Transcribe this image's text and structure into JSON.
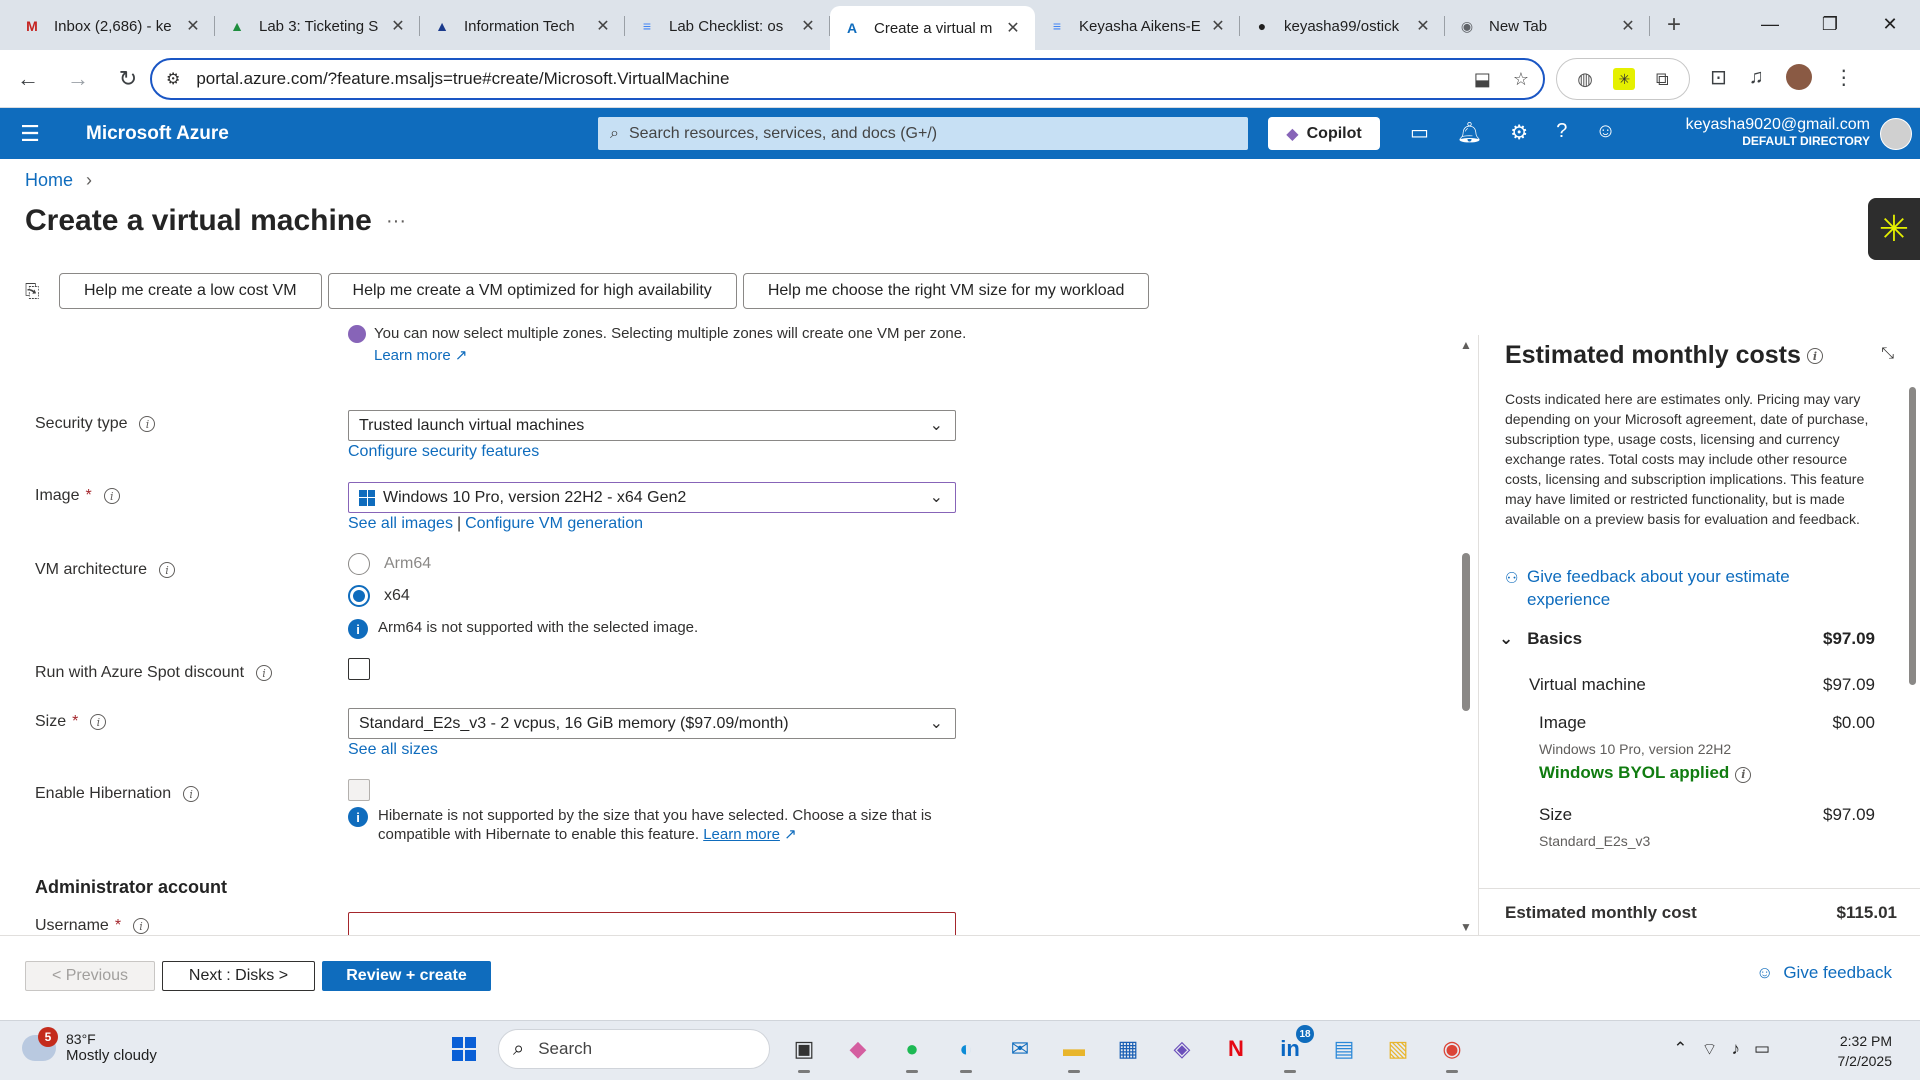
{
  "browser": {
    "tabs": [
      {
        "title": "Inbox (2,686) - ke",
        "icon": "gmail-icon",
        "color": "#c5221f",
        "glyph": "M"
      },
      {
        "title": "Lab 3: Ticketing S",
        "icon": "drive-icon",
        "color": "#1e8e3e",
        "glyph": "▲"
      },
      {
        "title": "Information Tech",
        "icon": "azure-devops-icon",
        "color": "#1a3a8c",
        "glyph": "▲"
      },
      {
        "title": "Lab Checklist: os",
        "icon": "docs-icon",
        "color": "#4285f4",
        "glyph": "≡"
      },
      {
        "title": "Create a virtual m",
        "icon": "azure-icon",
        "color": "#0f6cbd",
        "glyph": "A"
      },
      {
        "title": "Keyasha Aikens-E",
        "icon": "docs-icon",
        "color": "#4285f4",
        "glyph": "≡"
      },
      {
        "title": "keyasha99/ostick",
        "icon": "github-icon",
        "color": "#1f1f1f",
        "glyph": "●"
      },
      {
        "title": "New Tab",
        "icon": "chrome-icon",
        "color": "#5f6368",
        "glyph": "◉"
      }
    ],
    "url": "portal.azure.com/?feature.msaljs=true#create/Microsoft.VirtualMachine"
  },
  "azure": {
    "brand": "Microsoft Azure",
    "search_placeholder": "Search resources, services, and docs (G+/)",
    "copilot": "Copilot",
    "account_email": "keyasha9020@gmail.com",
    "account_dir": "DEFAULT DIRECTORY"
  },
  "page": {
    "breadcrumb_home": "Home",
    "title": "Create a virtual machine",
    "help_buttons": [
      "Help me create a low cost VM",
      "Help me create a VM optimized for high availability",
      "Help me choose the right VM size for my workload"
    ]
  },
  "form": {
    "zone_note": "You can now select multiple zones. Selecting multiple zones will create one VM per zone.",
    "zone_note_link": "Learn more",
    "security_type_label": "Security type",
    "security_type_value": "Trusted launch virtual machines",
    "security_link": "Configure security features",
    "image_label": "Image",
    "image_value": "Windows 10 Pro, version 22H2 - x64 Gen2",
    "image_link1": "See all images",
    "image_link2": "Configure VM generation",
    "arch_label": "VM architecture",
    "arch_opt1": "Arm64",
    "arch_opt2": "x64",
    "arch_note": "Arm64 is not supported with the selected image.",
    "spot_label": "Run with Azure Spot discount",
    "size_label": "Size",
    "size_value": "Standard_E2s_v3 - 2 vcpus, 16 GiB memory ($97.09/month)",
    "size_link": "See all sizes",
    "hibernation_label": "Enable Hibernation",
    "hibernation_note": "Hibernate is not supported by the size that you have selected. Choose a size that is compatible with Hibernate to enable this feature.",
    "hibernation_link": "Learn more",
    "admin_heading": "Administrator account",
    "username_label": "Username"
  },
  "costs": {
    "title": "Estimated monthly costs",
    "disclaimer": "Costs indicated here are estimates only. Pricing may vary depending on your Microsoft agreement, date of purchase, subscription type, usage costs, licensing and currency exchange rates. Total costs may include other resource costs, licensing and subscription implications. This feature may have limited or restricted functionality, but is made available on a preview basis for evaluation and feedback.",
    "feedback_link": "Give feedback about your estimate experience",
    "basics_label": "Basics",
    "basics_value": "$97.09",
    "vm_label": "Virtual machine",
    "vm_value": "$97.09",
    "image_label": "Image",
    "image_value": "$0.00",
    "image_sub": "Windows 10 Pro, version 22H2",
    "byol": "Windows BYOL applied",
    "size_label": "Size",
    "size_value": "$97.09",
    "size_sub": "Standard_E2s_v3",
    "total_label": "Estimated monthly cost",
    "total_value": "$115.01"
  },
  "footer": {
    "previous": "< Previous",
    "next": "Next : Disks >",
    "review": "Review + create",
    "give_feedback": "Give feedback"
  },
  "taskbar": {
    "weather_temp": "83°F",
    "weather_desc": "Mostly cloudy",
    "weather_badge": "5",
    "search": "Search",
    "linkedin_badge": "18",
    "time": "2:32 PM",
    "date": "7/2/2025"
  }
}
